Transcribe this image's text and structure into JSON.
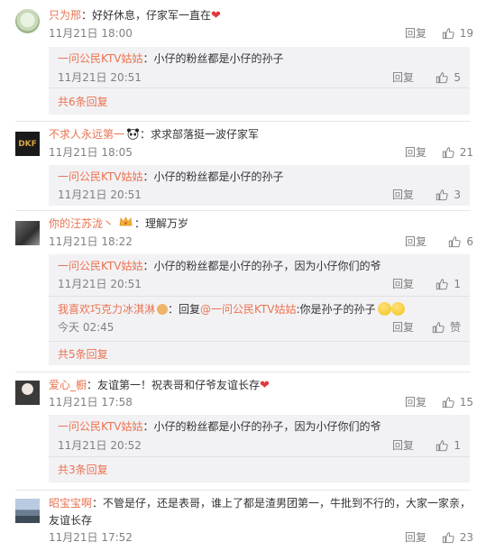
{
  "comments": [
    {
      "user": "只为邢",
      "text": "：好好休息，仔家军一直在",
      "emoji": "heart",
      "time": "11月21日 18:00",
      "reply_label": "回复",
      "likes": "19",
      "replies": [
        {
          "user": "一问公民KTV姑姑",
          "text": "：小仔的粉丝都是小仔的孙子",
          "time": "11月21日 20:51",
          "reply_label": "回复",
          "likes": "5"
        }
      ],
      "more": "共6条回复"
    },
    {
      "user": "不求人永远第一",
      "emoji": "panda",
      "text": "：求求部落挺一波仔家军",
      "time": "11月21日 18:05",
      "reply_label": "回复",
      "likes": "21",
      "replies": [
        {
          "user": "一问公民KTV姑姑",
          "text": "：小仔的粉丝都是小仔的孙子",
          "time": "11月21日 20:51",
          "reply_label": "回复",
          "likes": "3"
        }
      ]
    },
    {
      "user": "你的汪苏泷丶",
      "emoji": "crown",
      "text": "：理解万岁",
      "time": "11月21日 18:22",
      "reply_label": "回复",
      "likes": "6",
      "replies": [
        {
          "user": "一问公民KTV姑姑",
          "text": "：小仔的粉丝都是小仔的孙子，因为小仔你们的爷",
          "time": "11月21日 20:51",
          "reply_label": "回复",
          "likes": "1"
        },
        {
          "user": "我喜欢巧克力冰淇淋",
          "mid": "：回复",
          "mention": "@一问公民KTV姑姑",
          "text": ":你是孙子的孙子",
          "time": "今天 02:45",
          "reply_label": "回复",
          "likes": "赞"
        }
      ],
      "more": "共5条回复"
    },
    {
      "user": "爱心_橱",
      "text": "：友谊第一！祝表哥和仔爷友谊长存",
      "emoji": "heart",
      "time": "11月21日 17:58",
      "reply_label": "回复",
      "likes": "15",
      "replies": [
        {
          "user": "一问公民KTV姑姑",
          "text": "：小仔的粉丝都是小仔的孙子，因为小仔你们的爷",
          "time": "11月21日 20:52",
          "reply_label": "回复",
          "likes": "1"
        }
      ],
      "more": "共3条回复"
    },
    {
      "user": "昭宝宝啊",
      "text": "：不管是仔，还是表哥，谁上了都是渣男团第一，牛批到不行的，大家一家亲，",
      "text2": "友谊长存",
      "time": "11月21日 17:52",
      "reply_label": "回复",
      "likes": "23"
    }
  ]
}
